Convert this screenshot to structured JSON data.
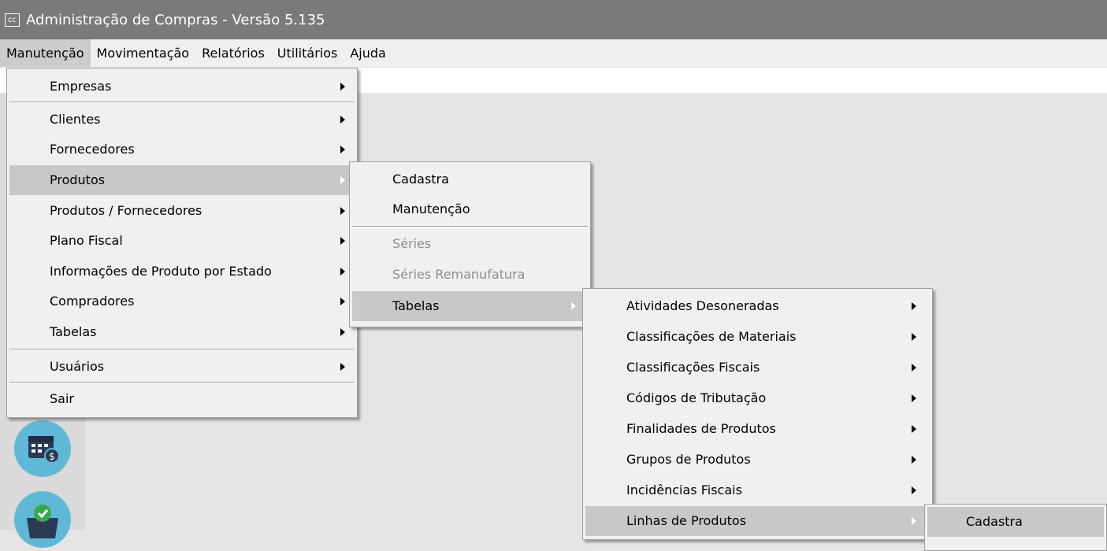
{
  "window": {
    "icon_text": "cc",
    "title": "Administração de Compras - Versão 5.135"
  },
  "menubar": {
    "items": [
      "Manutenção",
      "Movimentação",
      "Relatórios",
      "Utilitários",
      "Ajuda"
    ]
  },
  "menu_main": {
    "items": [
      "Empresas",
      "Clientes",
      "Fornecedores",
      "Produtos",
      "Produtos / Fornecedores",
      "Plano Fiscal",
      "Informações de Produto por Estado",
      "Compradores",
      "Tabelas",
      "Usuários",
      "Sair"
    ]
  },
  "menu_produtos": {
    "items": [
      "Cadastra",
      "Manutenção",
      "Séries",
      "Séries Remanufatura",
      "Tabelas"
    ]
  },
  "menu_tabelas": {
    "items": [
      "Atividades Desoneradas",
      "Classificações de Materiais",
      "Classificações Fiscais",
      "Códigos de Tributação",
      "Finalidades de Produtos",
      "Grupos de Produtos",
      "Incidências Fiscais",
      "Linhas de Produtos"
    ]
  },
  "menu_linhas": {
    "items": [
      "Cadastra"
    ]
  },
  "icons": [
    "calendar-money-icon",
    "basket-check-icon"
  ]
}
